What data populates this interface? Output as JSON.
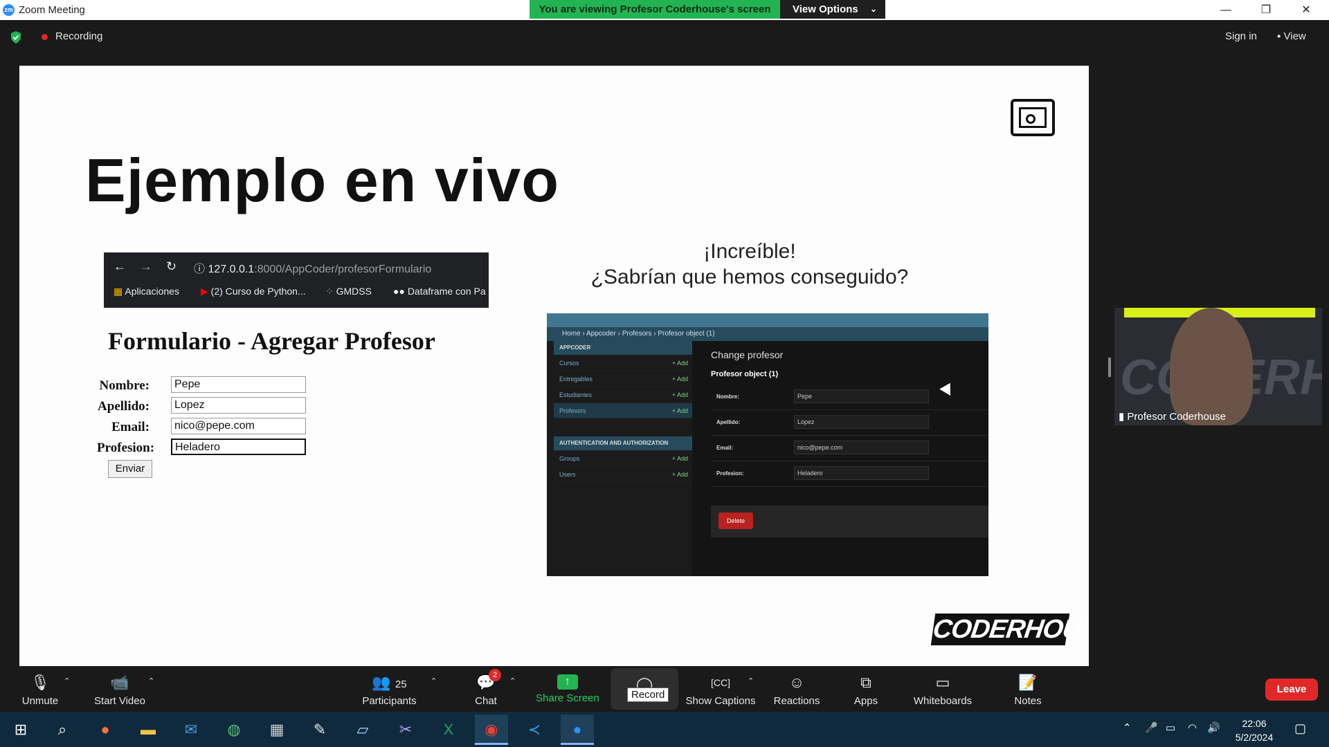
{
  "window": {
    "title": "Zoom Meeting",
    "banner": "You are viewing Profesor Coderhouse's screen",
    "view_options": "View Options",
    "minimize": "—",
    "restore": "❐",
    "close": "✕"
  },
  "topbar": {
    "recording": "Recording",
    "sign_in": "Sign in",
    "view": "View"
  },
  "slide": {
    "title": "Ejemplo en vivo",
    "browser": {
      "url_host": "127.0.0.1",
      "url_path": ":8000/AppCoder/profesorFormulario",
      "bookmarks": [
        "Aplicaciones",
        "(2) Curso de Python...",
        "GMDSS",
        "Dataframe con Pa"
      ]
    },
    "form": {
      "heading": "Formulario - Agregar Profesor",
      "fields": [
        {
          "label": "Nombre:",
          "value": "Pepe"
        },
        {
          "label": "Apellido:",
          "value": "Lopez"
        },
        {
          "label": "Email:",
          "value": "nico@pepe.com"
        },
        {
          "label": "Profesion:",
          "value": "Heladero"
        }
      ],
      "submit": "Enviar"
    },
    "headline_1": "¡Increíble!",
    "headline_2": "¿Sabrían que hemos conseguido?",
    "admin": {
      "breadcrumb": "Home › Appcoder › Profesors › Profesor object (1)",
      "section_1": "APPCODER",
      "models": [
        "Cursos",
        "Entregables",
        "Estudiantes",
        "Profesors"
      ],
      "section_2": "AUTHENTICATION AND AUTHORIZATION",
      "auth_models": [
        "Groups",
        "Users"
      ],
      "add_label": "+ Add",
      "change_title": "Change profesor",
      "object_title": "Profesor object (1)",
      "rows": [
        {
          "label": "Nombre:",
          "value": "Pepe"
        },
        {
          "label": "Apellido:",
          "value": "Lopez"
        },
        {
          "label": "Email:",
          "value": "nico@pepe.com"
        },
        {
          "label": "Profesion:",
          "value": "Heladero"
        }
      ],
      "delete": "Delete"
    },
    "logo": "CODERHOUSE"
  },
  "participant": {
    "name": "Profesor Coderhouse",
    "bg_text": "CODERHOUSE"
  },
  "toolbar": {
    "unmute": "Unmute",
    "start_video": "Start Video",
    "participants": "Participants",
    "participants_count": "25",
    "chat": "Chat",
    "chat_badge": "2",
    "share_screen": "Share Screen",
    "record": "Record",
    "show_captions": "Show Captions",
    "reactions": "Reactions",
    "apps": "Apps",
    "whiteboards": "Whiteboards",
    "notes": "Notes",
    "leave": "Leave"
  },
  "taskbar": {
    "time": "22:06",
    "date": "5/2/2024"
  }
}
